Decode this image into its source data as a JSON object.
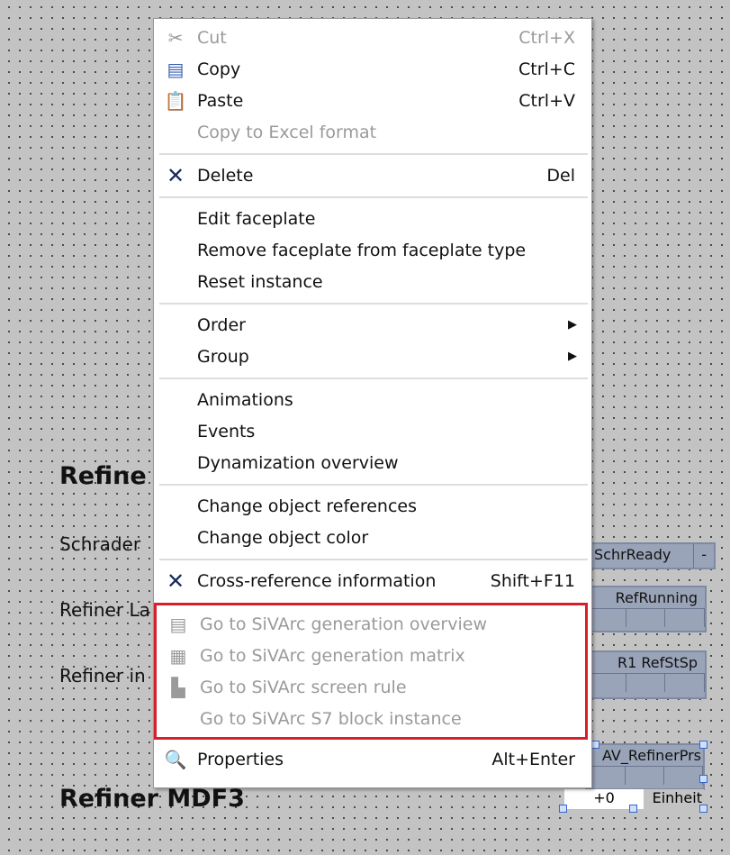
{
  "canvas": {
    "heading1": "Refine",
    "label_schrader": "Schrader",
    "label_refiner_la": "Refiner La",
    "label_refiner_in": "Refiner in",
    "heading2": "Refiner MDF3",
    "widgets": {
      "schr_ready": "SchrReady",
      "schr_ready_btn": "-",
      "ref_running": "RefRunning",
      "ref_stsp": "R1  RefStSp",
      "av_refiner_prs": "AV_RefinerPrs",
      "value": "+0",
      "unit": "Einheit"
    }
  },
  "menu": {
    "cut": {
      "label": "Cut",
      "shortcut": "Ctrl+X"
    },
    "copy": {
      "label": "Copy",
      "shortcut": "Ctrl+C"
    },
    "paste": {
      "label": "Paste",
      "shortcut": "Ctrl+V"
    },
    "copy_excel": {
      "label": "Copy to Excel format"
    },
    "delete": {
      "label": "Delete",
      "shortcut": "Del"
    },
    "edit_faceplate": {
      "label": "Edit faceplate"
    },
    "remove_faceplate": {
      "label": "Remove faceplate from faceplate type"
    },
    "reset_instance": {
      "label": "Reset instance"
    },
    "order": {
      "label": "Order"
    },
    "group": {
      "label": "Group"
    },
    "animations": {
      "label": "Animations"
    },
    "events": {
      "label": "Events"
    },
    "dynamization": {
      "label": "Dynamization overview"
    },
    "change_refs": {
      "label": "Change object references"
    },
    "change_color": {
      "label": "Change object color"
    },
    "cross_ref": {
      "label": "Cross-reference information",
      "shortcut": "Shift+F11"
    },
    "sivarc_overview": {
      "label": "Go to SiVArc generation overview"
    },
    "sivarc_matrix": {
      "label": "Go to SiVArc generation matrix"
    },
    "sivarc_screen": {
      "label": "Go to SiVArc screen rule"
    },
    "sivarc_s7": {
      "label": "Go to SiVArc S7 block instance"
    },
    "properties": {
      "label": "Properties",
      "shortcut": "Alt+Enter"
    }
  },
  "colors": {
    "highlight_box": "#d8202a",
    "disabled_text": "#9a9a9a"
  }
}
